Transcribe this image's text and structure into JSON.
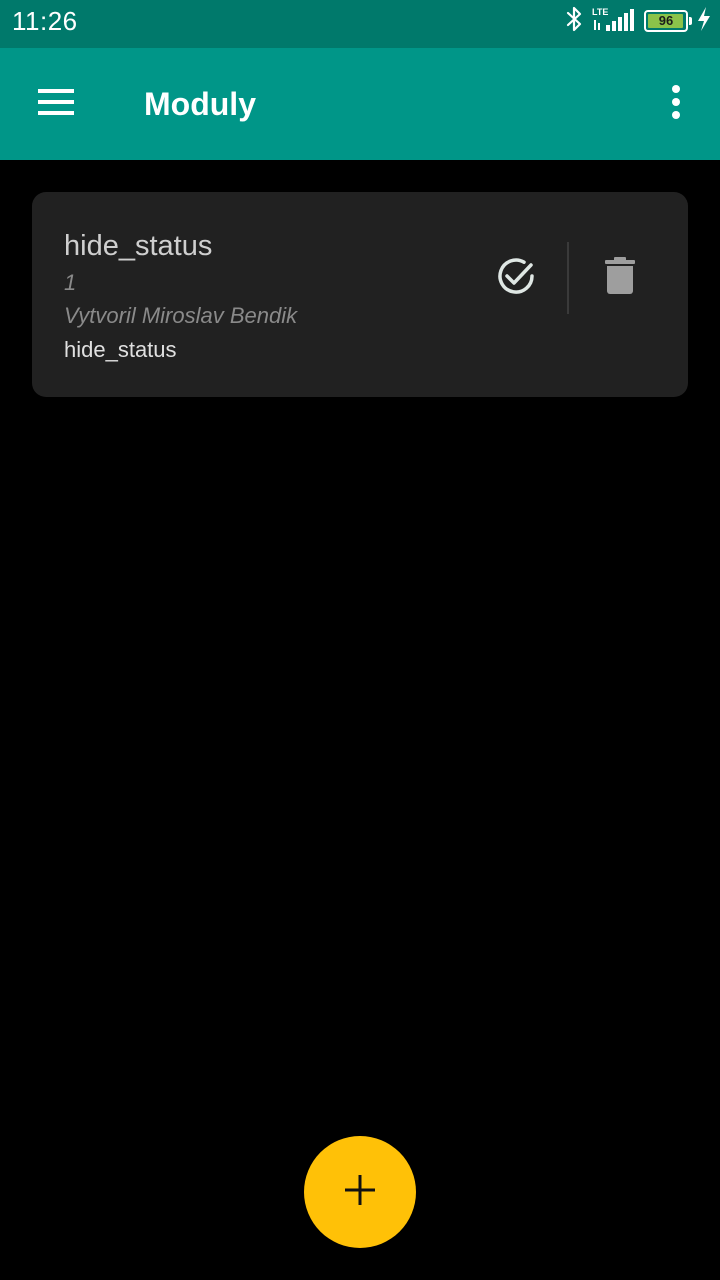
{
  "status_bar": {
    "time": "11:26",
    "network_type": "LTE",
    "battery_percent": 96,
    "battery_label": "96",
    "icons": [
      "bluetooth-icon",
      "signal-icon",
      "battery-icon",
      "charging-bolt-icon"
    ]
  },
  "app_bar": {
    "title": "Moduly",
    "menu_icon": "hamburger-menu-icon",
    "overflow_icon": "more-vertical-icon"
  },
  "modules": [
    {
      "name": "hide_status",
      "version": "1",
      "author": "Vytvoril Miroslav Bendik",
      "description": "hide_status",
      "status_icon": "check-circle-icon",
      "delete_icon": "trash-icon"
    }
  ],
  "fab": {
    "icon": "plus-icon"
  },
  "colors": {
    "status_bar": "#00796b",
    "app_bar": "#009688",
    "background": "#000000",
    "card": "#212121",
    "fab": "#ffc107",
    "battery_fill": "#8bc34a"
  }
}
